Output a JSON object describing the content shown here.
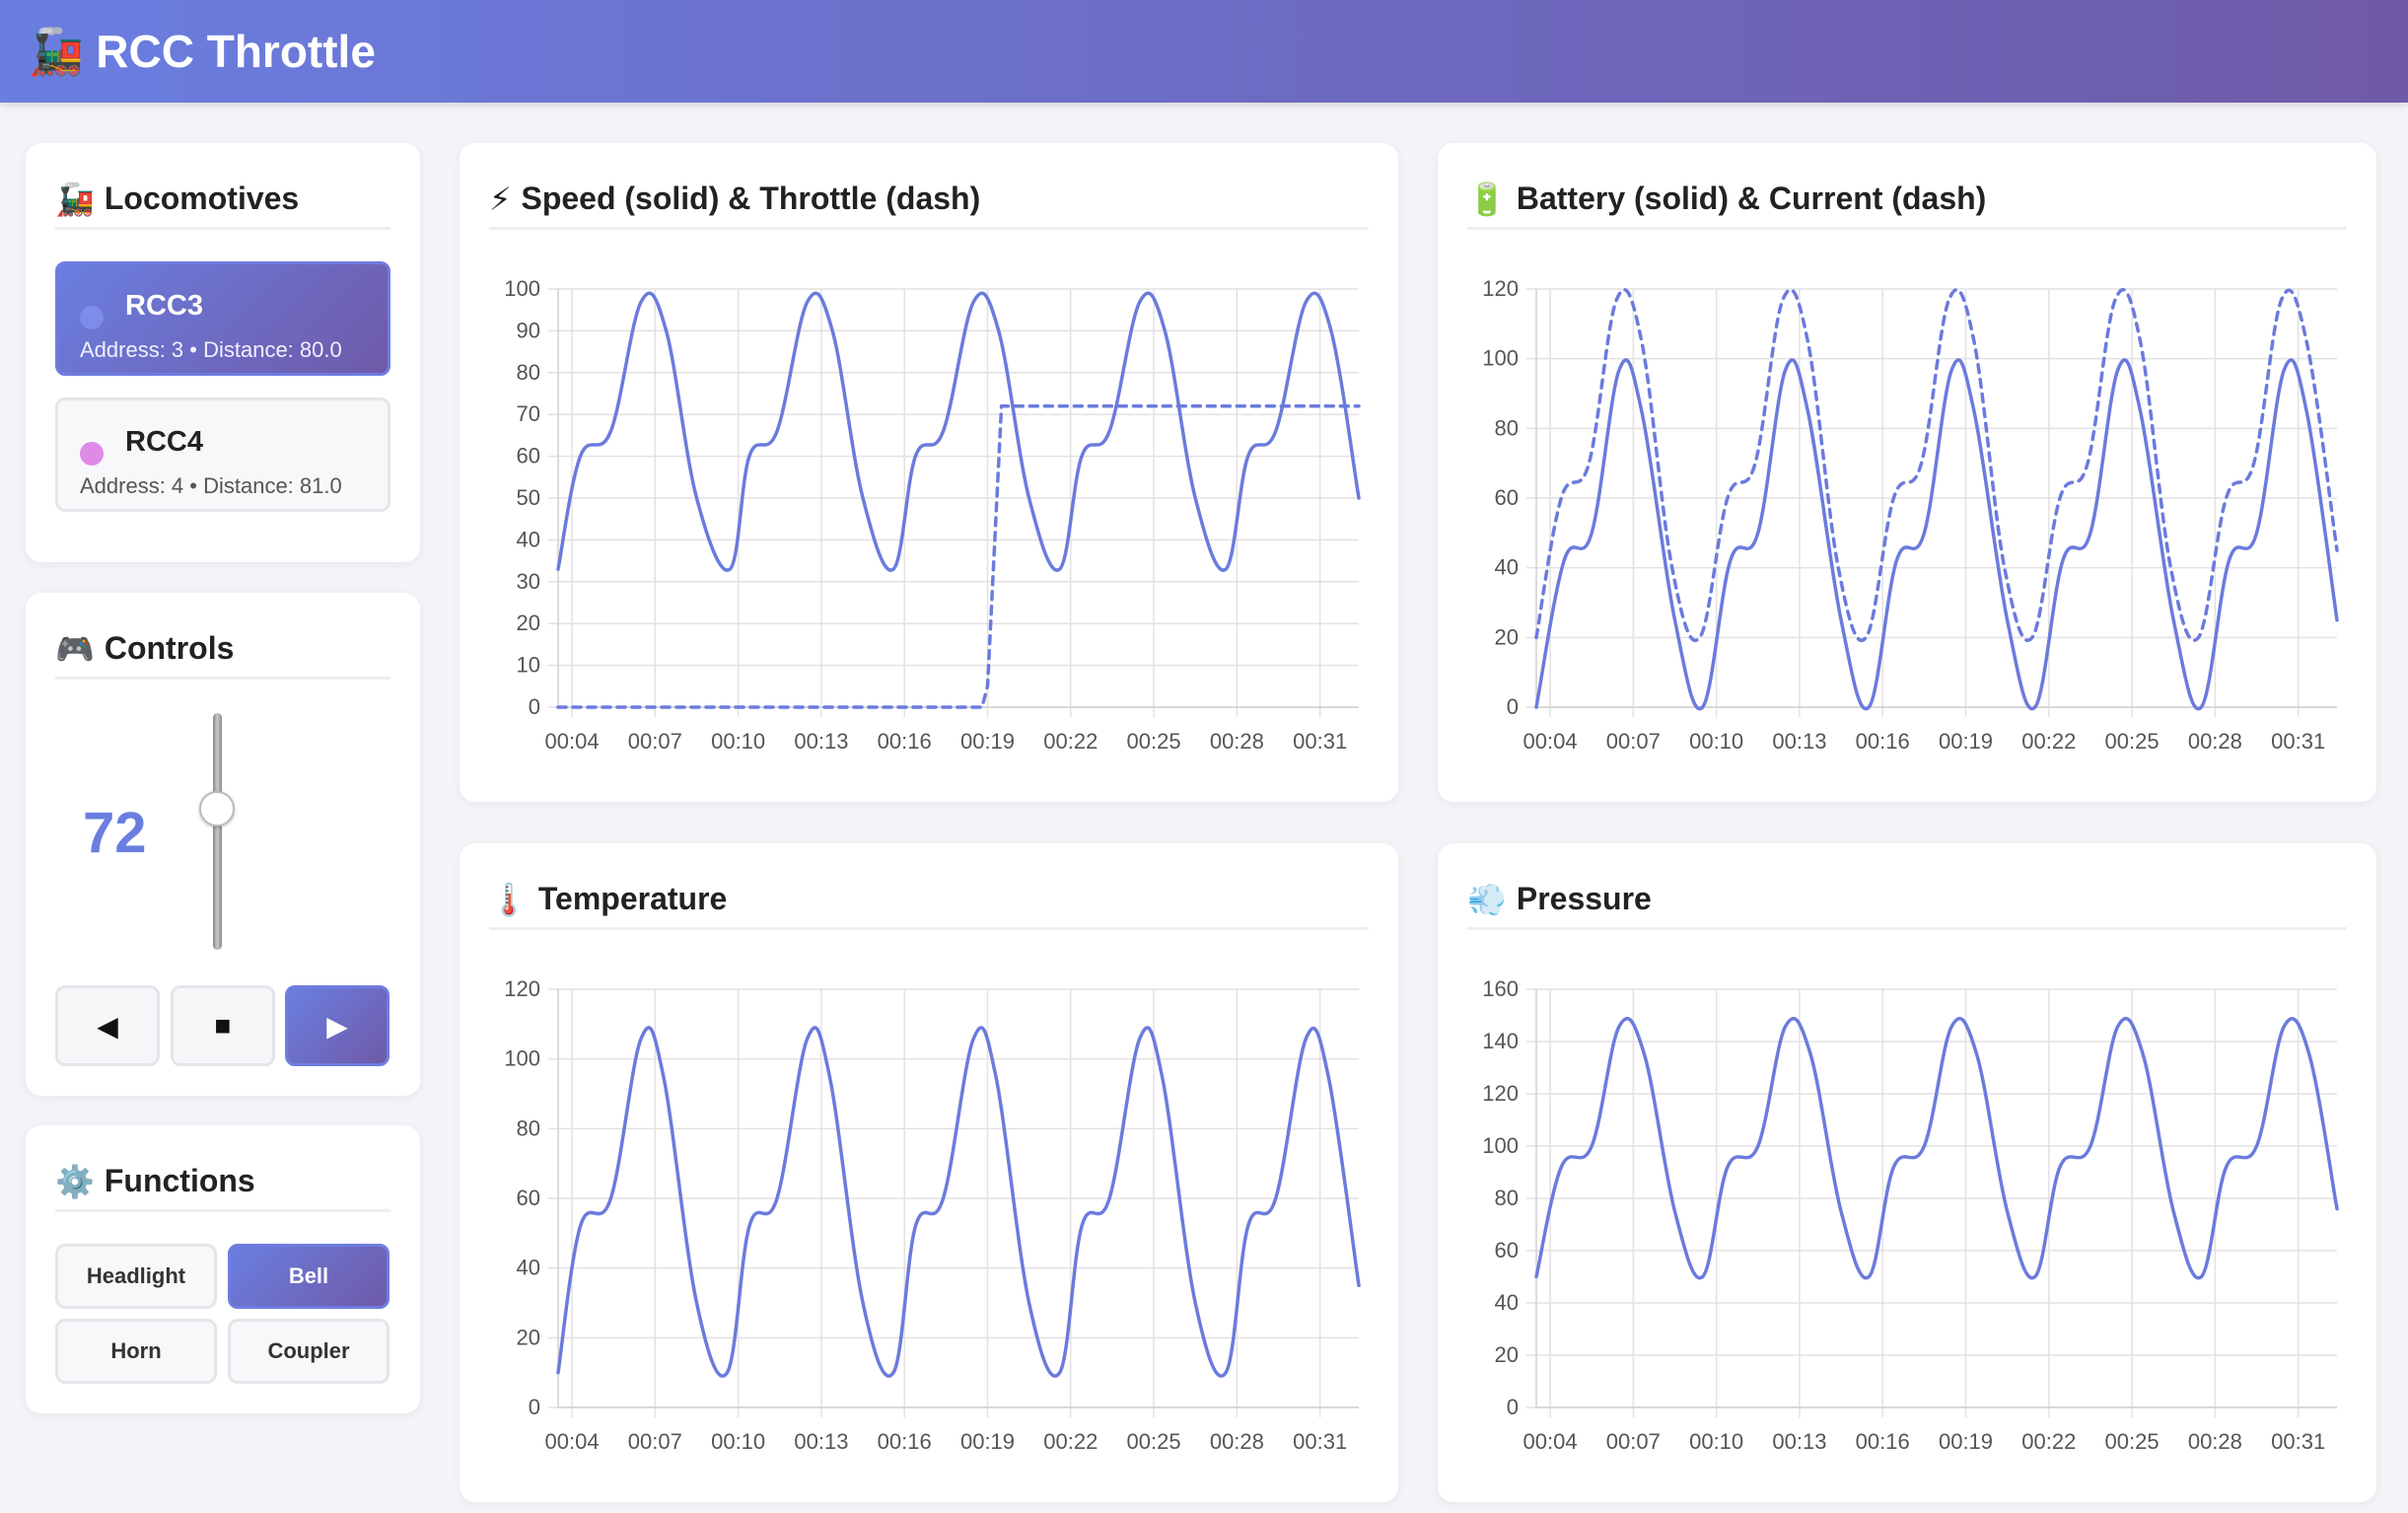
{
  "app": {
    "title": "RCC Throttle",
    "logo_icon": "locomotive-icon"
  },
  "locomotives": {
    "title": "Locomotives",
    "items": [
      {
        "name": "RCC3",
        "info": "Address: 3 • Distance: 80.0",
        "dot_color": "#6a7ee0",
        "selected": true
      },
      {
        "name": "RCC4",
        "info": "Address: 4 • Distance: 81.0",
        "dot_color": "#e08ae8",
        "selected": false
      }
    ]
  },
  "controls": {
    "title": "Controls",
    "speed": "72",
    "throttle_level": 72,
    "reverse_label": "◀",
    "stop_label": "■",
    "forward_label": "▶"
  },
  "functions": {
    "title": "Functions",
    "buttons": [
      {
        "label": "Headlight",
        "on": false
      },
      {
        "label": "Bell",
        "on": true
      },
      {
        "label": "Horn",
        "on": false
      },
      {
        "label": "Coupler",
        "on": false
      }
    ]
  },
  "colors": {
    "accent": "#6a7ee0",
    "accent_dark": "#6f5aa8",
    "line": "#6b7bdc"
  },
  "chart_data": [
    {
      "id": "speed",
      "type": "line",
      "title": "Speed (solid) & Throttle (dash)",
      "icon": "lightning-icon",
      "x": [
        "00:04",
        "00:07",
        "00:10",
        "00:13",
        "00:16",
        "00:19",
        "00:22",
        "00:25",
        "00:28",
        "00:31"
      ],
      "ylim": [
        0,
        100
      ],
      "yticks": [
        0,
        10,
        20,
        30,
        40,
        50,
        60,
        70,
        80,
        90,
        100
      ],
      "xlim": [
        3.5,
        32.4
      ],
      "grid": true,
      "series": [
        {
          "style": "solid",
          "points": [
            [
              3.5,
              33
            ],
            [
              4.3,
              60
            ],
            [
              5.4,
              66
            ],
            [
              6.5,
              97
            ],
            [
              7.4,
              90
            ],
            [
              8.5,
              50
            ],
            [
              9.7,
              33
            ],
            [
              10.4,
              60
            ],
            [
              11.4,
              66
            ],
            [
              12.5,
              97
            ],
            [
              13.4,
              90
            ],
            [
              14.5,
              50
            ],
            [
              15.6,
              33
            ],
            [
              16.4,
              60
            ],
            [
              17.4,
              66
            ],
            [
              18.5,
              97
            ],
            [
              19.4,
              90
            ],
            [
              20.5,
              50
            ],
            [
              21.6,
              33
            ],
            [
              22.4,
              60
            ],
            [
              23.4,
              66
            ],
            [
              24.5,
              97
            ],
            [
              25.4,
              90
            ],
            [
              26.5,
              50
            ],
            [
              27.6,
              33
            ],
            [
              28.4,
              60
            ],
            [
              29.4,
              66
            ],
            [
              30.5,
              97
            ],
            [
              31.4,
              90
            ],
            [
              32.4,
              50
            ]
          ]
        },
        {
          "style": "dash",
          "points": [
            [
              3.5,
              0
            ],
            [
              18.8,
              0
            ],
            [
              19.0,
              5
            ],
            [
              19.5,
              72
            ],
            [
              32.4,
              72
            ]
          ]
        }
      ]
    },
    {
      "id": "battery",
      "type": "line",
      "title": "Battery (solid) & Current (dash)",
      "icon": "battery-icon",
      "x": [
        "00:04",
        "00:07",
        "00:10",
        "00:13",
        "00:16",
        "00:19",
        "00:22",
        "00:25",
        "00:28",
        "00:31"
      ],
      "ylim": [
        0,
        120
      ],
      "yticks": [
        0,
        20,
        40,
        60,
        80,
        100,
        120
      ],
      "xlim": [
        3.5,
        32.4
      ],
      "grid": true,
      "series": [
        {
          "style": "solid",
          "points": [
            [
              3.5,
              0
            ],
            [
              4.5,
              42
            ],
            [
              5.5,
              50
            ],
            [
              6.5,
              97
            ],
            [
              7.3,
              85
            ],
            [
              8.5,
              25
            ],
            [
              9.5,
              0
            ],
            [
              10.5,
              42
            ],
            [
              11.5,
              50
            ],
            [
              12.5,
              97
            ],
            [
              13.3,
              85
            ],
            [
              14.5,
              25
            ],
            [
              15.5,
              0
            ],
            [
              16.5,
              42
            ],
            [
              17.5,
              50
            ],
            [
              18.5,
              97
            ],
            [
              19.3,
              85
            ],
            [
              20.5,
              25
            ],
            [
              21.5,
              0
            ],
            [
              22.5,
              42
            ],
            [
              23.5,
              50
            ],
            [
              24.5,
              97
            ],
            [
              25.3,
              85
            ],
            [
              26.5,
              25
            ],
            [
              27.5,
              0
            ],
            [
              28.5,
              42
            ],
            [
              29.5,
              50
            ],
            [
              30.5,
              97
            ],
            [
              31.3,
              85
            ],
            [
              32.4,
              25
            ]
          ]
        },
        {
          "style": "dash",
          "points": [
            [
              3.5,
              20
            ],
            [
              4.4,
              60
            ],
            [
              5.4,
              70
            ],
            [
              6.4,
              117
            ],
            [
              7.3,
              105
            ],
            [
              8.4,
              40
            ],
            [
              9.4,
              20
            ],
            [
              10.4,
              60
            ],
            [
              11.4,
              70
            ],
            [
              12.4,
              117
            ],
            [
              13.3,
              105
            ],
            [
              14.4,
              40
            ],
            [
              15.4,
              20
            ],
            [
              16.4,
              60
            ],
            [
              17.4,
              70
            ],
            [
              18.4,
              117
            ],
            [
              19.3,
              105
            ],
            [
              20.4,
              40
            ],
            [
              21.4,
              20
            ],
            [
              22.4,
              60
            ],
            [
              23.4,
              70
            ],
            [
              24.4,
              117
            ],
            [
              25.3,
              105
            ],
            [
              26.4,
              40
            ],
            [
              27.4,
              20
            ],
            [
              28.4,
              60
            ],
            [
              29.4,
              70
            ],
            [
              30.4,
              117
            ],
            [
              31.3,
              105
            ],
            [
              32.4,
              45
            ]
          ]
        }
      ]
    },
    {
      "id": "temperature",
      "type": "line",
      "title": "Temperature",
      "icon": "thermometer-icon",
      "x": [
        "00:04",
        "00:07",
        "00:10",
        "00:13",
        "00:16",
        "00:19",
        "00:22",
        "00:25",
        "00:28",
        "00:31"
      ],
      "ylim": [
        0,
        120
      ],
      "yticks": [
        0,
        20,
        40,
        60,
        80,
        100,
        120
      ],
      "xlim": [
        3.5,
        32.4
      ],
      "grid": true,
      "series": [
        {
          "style": "solid",
          "points": [
            [
              3.5,
              10
            ],
            [
              4.3,
              52
            ],
            [
              5.4,
              60
            ],
            [
              6.5,
              106
            ],
            [
              7.3,
              95
            ],
            [
              8.5,
              30
            ],
            [
              9.6,
              10
            ],
            [
              10.4,
              52
            ],
            [
              11.4,
              60
            ],
            [
              12.5,
              106
            ],
            [
              13.3,
              95
            ],
            [
              14.5,
              30
            ],
            [
              15.6,
              10
            ],
            [
              16.4,
              52
            ],
            [
              17.4,
              60
            ],
            [
              18.5,
              106
            ],
            [
              19.3,
              95
            ],
            [
              20.5,
              30
            ],
            [
              21.6,
              10
            ],
            [
              22.4,
              52
            ],
            [
              23.4,
              60
            ],
            [
              24.5,
              106
            ],
            [
              25.3,
              95
            ],
            [
              26.5,
              30
            ],
            [
              27.6,
              10
            ],
            [
              28.4,
              52
            ],
            [
              29.4,
              60
            ],
            [
              30.5,
              106
            ],
            [
              31.3,
              95
            ],
            [
              32.4,
              35
            ]
          ]
        }
      ]
    },
    {
      "id": "pressure",
      "type": "line",
      "title": "Pressure",
      "icon": "wind-icon",
      "x": [
        "00:04",
        "00:07",
        "00:10",
        "00:13",
        "00:16",
        "00:19",
        "00:22",
        "00:25",
        "00:28",
        "00:31"
      ],
      "ylim": [
        0,
        160
      ],
      "yticks": [
        0,
        20,
        40,
        60,
        80,
        100,
        120,
        140,
        160
      ],
      "xlim": [
        3.5,
        32.4
      ],
      "grid": true,
      "series": [
        {
          "style": "solid",
          "points": [
            [
              3.5,
              50
            ],
            [
              4.4,
              92
            ],
            [
              5.5,
              100
            ],
            [
              6.5,
              146
            ],
            [
              7.4,
              135
            ],
            [
              8.5,
              75
            ],
            [
              9.5,
              50
            ],
            [
              10.4,
              92
            ],
            [
              11.5,
              100
            ],
            [
              12.5,
              146
            ],
            [
              13.4,
              135
            ],
            [
              14.5,
              75
            ],
            [
              15.5,
              50
            ],
            [
              16.4,
              92
            ],
            [
              17.5,
              100
            ],
            [
              18.5,
              146
            ],
            [
              19.4,
              135
            ],
            [
              20.5,
              75
            ],
            [
              21.5,
              50
            ],
            [
              22.4,
              92
            ],
            [
              23.5,
              100
            ],
            [
              24.5,
              146
            ],
            [
              25.4,
              135
            ],
            [
              26.5,
              75
            ],
            [
              27.5,
              50
            ],
            [
              28.4,
              92
            ],
            [
              29.5,
              100
            ],
            [
              30.5,
              146
            ],
            [
              31.4,
              135
            ],
            [
              32.4,
              76
            ]
          ]
        }
      ]
    }
  ]
}
